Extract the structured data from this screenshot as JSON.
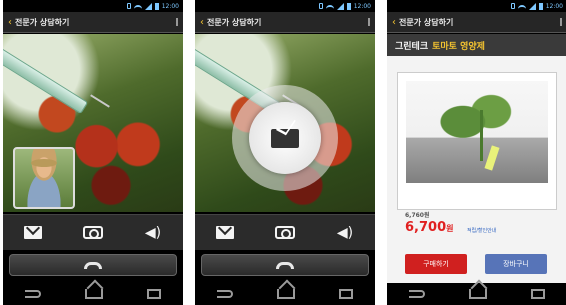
{
  "status_bar": {
    "time": "12:00"
  },
  "header": {
    "title": "전문가 상담하기"
  },
  "product": {
    "brand": "그린테크",
    "name": "토마토 영양제",
    "price_small": "6,760원",
    "price": "6,700",
    "price_unit": "원",
    "price_note": "적립/할인안내",
    "buy_label": "구매하기",
    "cart_label": "장바구니"
  }
}
